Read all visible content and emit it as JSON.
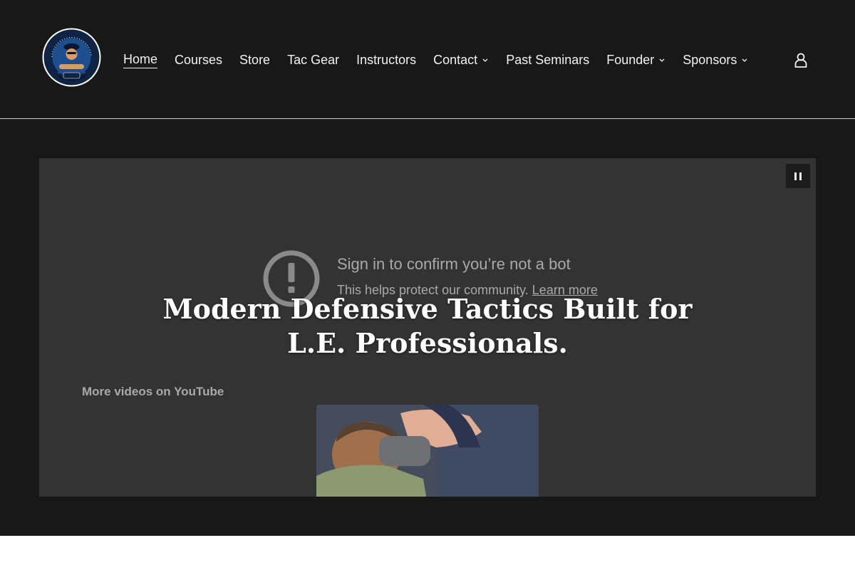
{
  "header": {
    "logo": {
      "top_text": "BRAZILIAN JIU-JITSU",
      "bottom_text": "COPS"
    },
    "nav": [
      {
        "label": "Home",
        "active": true,
        "dropdown": false
      },
      {
        "label": "Courses",
        "active": false,
        "dropdown": false
      },
      {
        "label": "Store",
        "active": false,
        "dropdown": false
      },
      {
        "label": "Tac Gear",
        "active": false,
        "dropdown": false
      },
      {
        "label": "Instructors",
        "active": false,
        "dropdown": false
      },
      {
        "label": "Contact",
        "active": false,
        "dropdown": true
      },
      {
        "label": "Past Seminars",
        "active": false,
        "dropdown": false
      },
      {
        "label": "Founder",
        "active": false,
        "dropdown": true
      },
      {
        "label": "Sponsors",
        "active": false,
        "dropdown": true
      }
    ],
    "account_icon": "user-icon"
  },
  "hero": {
    "video": {
      "bot_check_title": "Sign in to confirm you’re not a bot",
      "bot_check_subtitle": "This helps protect our community.",
      "learn_more": "Learn more",
      "more_videos": "More videos on YouTube",
      "pause_icon": "pause-icon",
      "warning_icon": "exclamation-circle-icon"
    },
    "headline_line1": "Modern Defensive Tactics Built for",
    "headline_line2": "L.E. Professionals."
  },
  "colors": {
    "header_bg": "#181818",
    "video_bg": "#333333",
    "nav_text": "#f2f2f2",
    "muted_text": "#a9a9a9"
  }
}
